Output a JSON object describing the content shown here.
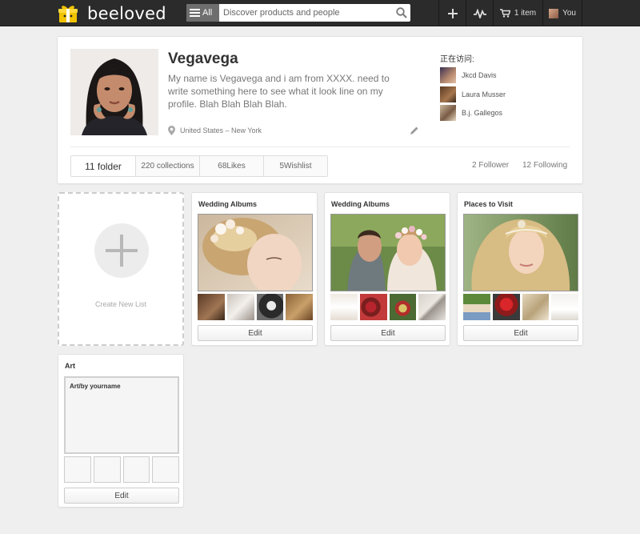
{
  "brand": {
    "name": "beeloved"
  },
  "search": {
    "scope": "All",
    "placeholder": "Discover products and people"
  },
  "nav": {
    "cart_label": "1 item",
    "user_label": "You"
  },
  "profile": {
    "name": "Vegavega",
    "bio": "My name is Vegavega and i am from XXXX. need to write something here to see what it look line on my profile. Blah Blah Blah Blah.",
    "location": "United States – New York",
    "visitors_title": "正在访问:",
    "visitors": [
      "Jkcd Davis",
      "Laura Musser",
      "B.j. Gallegos"
    ],
    "stats": [
      "11 folder",
      "220 collections",
      "68Likes",
      "5Wishlist"
    ],
    "followers": "2 Follower",
    "following": "12 Following"
  },
  "create": {
    "label": "Create New List"
  },
  "lists": [
    {
      "title": "Wedding Albums",
      "edit": "Edit"
    },
    {
      "title": "Wedding Albums",
      "edit": "Edit"
    },
    {
      "title": "Places to Visit",
      "edit": "Edit"
    },
    {
      "title": "Art",
      "subtitle": "Art/by yourname",
      "edit": "Edit"
    }
  ],
  "colors": {
    "topbar": "#2b2b2b",
    "page_bg": "#efefef",
    "card": "#ffffff",
    "accent_logo": "#f2c400"
  }
}
